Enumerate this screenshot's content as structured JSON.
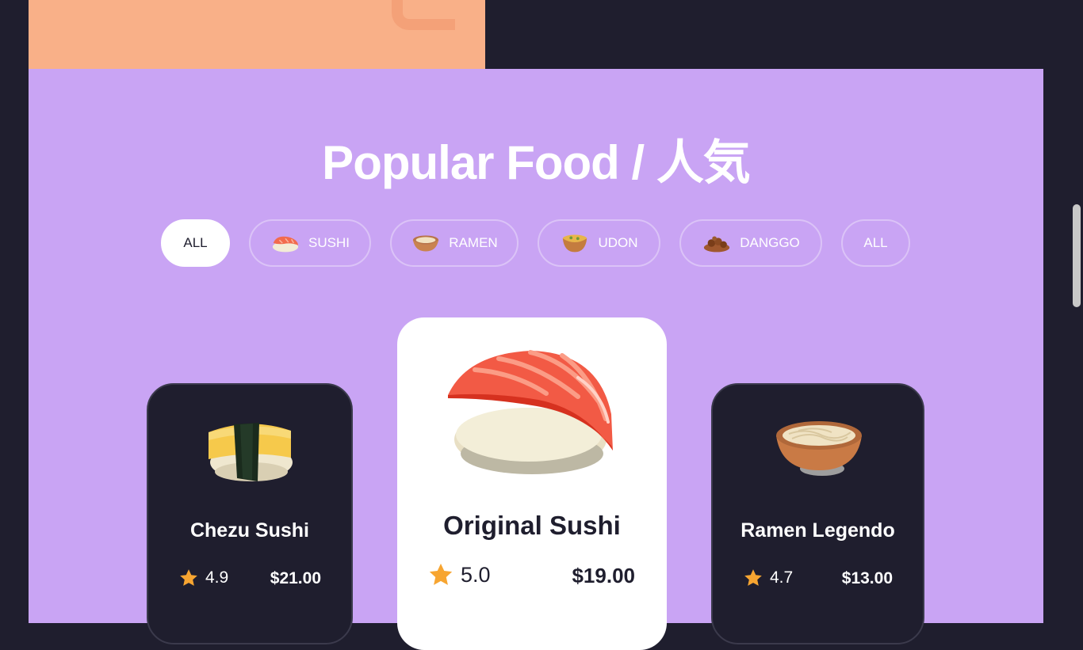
{
  "title": "Popular Food / 人気",
  "filters": [
    {
      "label": "ALL",
      "icon": "",
      "active": true
    },
    {
      "label": "SUSHI",
      "icon": "sushi-icon",
      "active": false
    },
    {
      "label": "RAMEN",
      "icon": "ramen-bowl-icon",
      "active": false
    },
    {
      "label": "UDON",
      "icon": "udon-bowl-icon",
      "active": false
    },
    {
      "label": "DANGGO",
      "icon": "danggo-dish-icon",
      "active": false
    },
    {
      "label": "ALL",
      "icon": "",
      "active": false
    }
  ],
  "cards": [
    {
      "name": "Chezu Sushi",
      "rating": "4.9",
      "price": "$21.00",
      "image": "egg-sushi-image"
    },
    {
      "name": "Original Sushi",
      "rating": "5.0",
      "price": "$19.00",
      "image": "salmon-sushi-image"
    },
    {
      "name": "Ramen Legendo",
      "rating": "4.7",
      "price": "$13.00",
      "image": "ramen-bowl-image"
    }
  ],
  "colors": {
    "section_bg": "#c9a4f4",
    "dark_bg": "#1f1e2e",
    "peach": "#f9b088",
    "star": "#f7a531"
  }
}
